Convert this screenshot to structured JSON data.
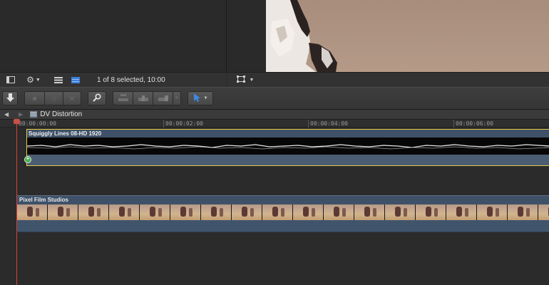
{
  "browser": {
    "selection_status": "1 of 8 selected, 10:00",
    "icons": [
      "sidebar-toggle-icon",
      "gear-icon",
      "filmstrip-view-icon",
      "list-view-icon"
    ]
  },
  "viewer": {
    "icons": [
      "transform-icon",
      "chevron-down-icon"
    ]
  },
  "toolbar": {
    "icons": [
      "import-icon",
      "favorite-star-icon",
      "reject-icon",
      "keyword-icon",
      "connect-clip-icon",
      "insert-clip-icon",
      "append-clip-icon",
      "select-tool-icon"
    ]
  },
  "timeline": {
    "project_name": "DV Distortion",
    "ruler_labels": [
      "00:00:00:00",
      "00:00:02:00",
      "00:00:04:00",
      "00:00:06:00"
    ],
    "clips": [
      {
        "title": "Squiggly Lines 08-HD 1920",
        "selected": true
      },
      {
        "title": "Pixel Film Studios",
        "selected": false
      }
    ],
    "colors": {
      "playhead": "#d2413a",
      "selection": "#e8c84a",
      "clip": "#3e5168",
      "marker": "#49b04a"
    }
  }
}
